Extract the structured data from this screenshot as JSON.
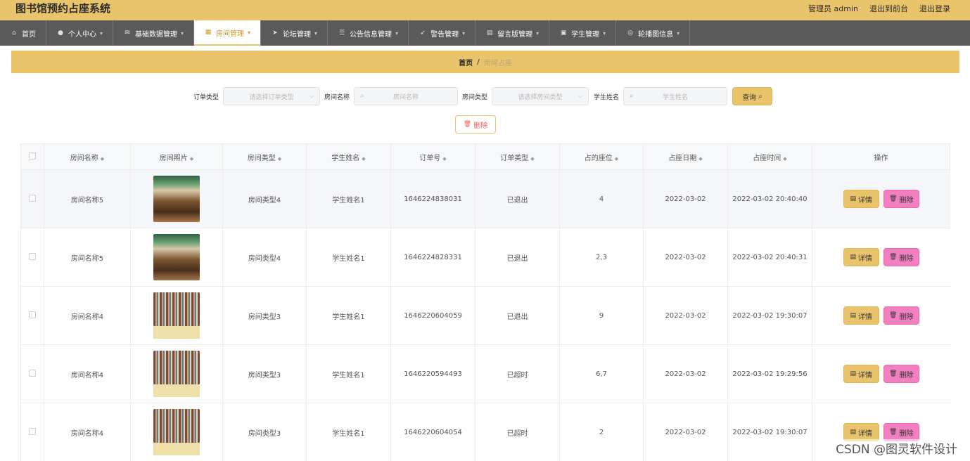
{
  "header": {
    "title": "图书馆预约占座系统",
    "admin": "管理员 admin",
    "exit_front": "退出到前台",
    "logout": "退出登录"
  },
  "nav": {
    "items": [
      {
        "label": "首页",
        "icon": "home-icon",
        "glyph": "⌂"
      },
      {
        "label": "个人中心",
        "icon": "user-icon",
        "glyph": "●"
      },
      {
        "label": "基础数据管理",
        "icon": "mail-icon",
        "glyph": "✉"
      },
      {
        "label": "房间管理",
        "icon": "building-icon",
        "glyph": "▦"
      },
      {
        "label": "论坛管理",
        "icon": "send-icon",
        "glyph": "➤"
      },
      {
        "label": "公告信息管理",
        "icon": "list-icon",
        "glyph": "☰"
      },
      {
        "label": "警告管理",
        "icon": "paper-plane-icon",
        "glyph": "➶"
      },
      {
        "label": "留言版管理",
        "icon": "briefcase-icon",
        "glyph": "▤"
      },
      {
        "label": "学生管理",
        "icon": "document-icon",
        "glyph": "▣"
      },
      {
        "label": "轮播图信息",
        "icon": "compass-icon",
        "glyph": "◎"
      }
    ],
    "caret": "▾"
  },
  "breadcrumb": {
    "home": "首页",
    "sep": "/",
    "current": "房间占座"
  },
  "filters": {
    "order_type_label": "订单类型",
    "order_type_placeholder": "请选择订单类型",
    "room_name_label": "房间名称",
    "room_name_placeholder": "房间名称",
    "room_type_label": "房间类型",
    "room_type_placeholder": "请选择房间类型",
    "student_name_label": "学生姓名",
    "student_name_placeholder": "学生姓名",
    "query_label": "查询",
    "select_glyph": "⌵",
    "search_glyph": "⌕"
  },
  "toolbar": {
    "delete_label": "删除",
    "delete_glyph": "🗑"
  },
  "table": {
    "headers": {
      "room_name": "房间名称",
      "room_photo": "房间照片",
      "room_type": "房间类型",
      "student_name": "学生姓名",
      "order_no": "订单号",
      "order_type": "订单类型",
      "seats": "占的座位",
      "date": "占座日期",
      "time": "占座时间",
      "actions": "操作"
    },
    "sort_glyph": "◆",
    "detail_label": "详情",
    "detail_glyph": "▤",
    "delete_label": "删除",
    "delete_glyph": "🗑",
    "rows": [
      {
        "room_name": "房间名称5",
        "room_type": "房间类型4",
        "student_name": "学生姓名1",
        "order_no": "1646224838031",
        "order_type": "已退出",
        "seats": "4",
        "date": "2022-03-02",
        "time": "2022-03-02 20:40:40",
        "photo": "study-hall"
      },
      {
        "room_name": "房间名称5",
        "room_type": "房间类型4",
        "student_name": "学生姓名1",
        "order_no": "1646224828331",
        "order_type": "已退出",
        "seats": "2,3",
        "date": "2022-03-02",
        "time": "2022-03-02 20:40:31",
        "photo": "study-hall"
      },
      {
        "room_name": "房间名称4",
        "room_type": "房间类型3",
        "student_name": "学生姓名1",
        "order_no": "1646220604059",
        "order_type": "已退出",
        "seats": "9",
        "date": "2022-03-02",
        "time": "2022-03-02 19:30:07",
        "photo": "bookshelf"
      },
      {
        "room_name": "房间名称4",
        "room_type": "房间类型3",
        "student_name": "学生姓名1",
        "order_no": "1646220594493",
        "order_type": "已超时",
        "seats": "6,7",
        "date": "2022-03-02",
        "time": "2022-03-02 19:29:56",
        "photo": "bookshelf"
      },
      {
        "room_name": "房间名称4",
        "room_type": "房间类型3",
        "student_name": "学生姓名1",
        "order_no": "1646220604054",
        "order_type": "已超时",
        "seats": "2",
        "date": "2022-03-02",
        "time": "2022-03-02 19:30:07",
        "photo": "bookshelf"
      }
    ]
  },
  "watermark": "CSDN @图灵软件设计",
  "colors": {
    "accent": "#e9c46a",
    "nav_bg": "#5a5a5a",
    "danger": "#f27fc0"
  }
}
